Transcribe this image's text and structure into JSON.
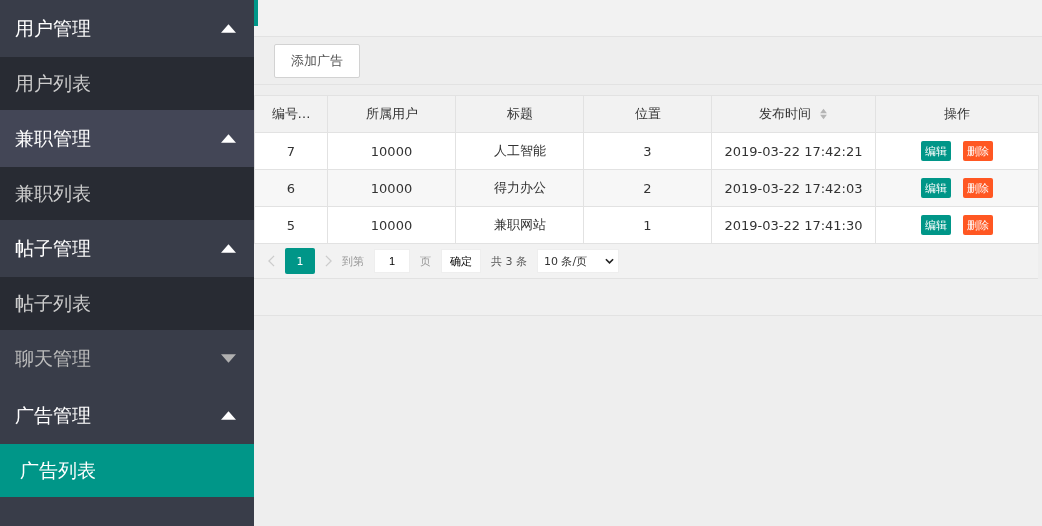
{
  "sidebar": {
    "groups": [
      {
        "label": "用户管理",
        "expanded": true,
        "hovered": false,
        "items": [
          {
            "label": "用户列表",
            "selected": false
          }
        ]
      },
      {
        "label": "兼职管理",
        "expanded": true,
        "hovered": true,
        "items": [
          {
            "label": "兼职列表",
            "selected": false
          }
        ]
      },
      {
        "label": "帖子管理",
        "expanded": true,
        "hovered": false,
        "items": [
          {
            "label": "帖子列表",
            "selected": false
          }
        ]
      },
      {
        "label": "聊天管理",
        "expanded": false,
        "hovered": false
      },
      {
        "label": "广告管理",
        "expanded": true,
        "hovered": false,
        "items": [
          {
            "label": "广告列表",
            "selected": true
          }
        ]
      }
    ]
  },
  "toolbar": {
    "add_button": "添加广告"
  },
  "table": {
    "columns": [
      {
        "label": "编号…",
        "sortable": false
      },
      {
        "label": "所属用户",
        "sortable": false
      },
      {
        "label": "标题",
        "sortable": false
      },
      {
        "label": "位置",
        "sortable": false
      },
      {
        "label": "发布时间",
        "sortable": true
      },
      {
        "label": "操作",
        "sortable": false
      }
    ],
    "rows": [
      {
        "cells": [
          "7",
          "10000",
          "人工智能",
          "3",
          "2019-03-22 17:42:21"
        ],
        "actions": [
          "编辑",
          "删除"
        ]
      },
      {
        "cells": [
          "6",
          "10000",
          "得力办公",
          "2",
          "2019-03-22 17:42:03"
        ],
        "actions": [
          "编辑",
          "删除"
        ]
      },
      {
        "cells": [
          "5",
          "10000",
          "兼职网站",
          "1",
          "2019-03-22 17:41:30"
        ],
        "actions": [
          "编辑",
          "删除"
        ]
      }
    ]
  },
  "pagination": {
    "pages": [
      {
        "label": "1",
        "selected": true
      }
    ],
    "goto_label": "到第",
    "goto_value": "1",
    "page_unit": "页",
    "confirm": "确定",
    "total": "共 3 条",
    "page_size": "10 条/页"
  }
}
